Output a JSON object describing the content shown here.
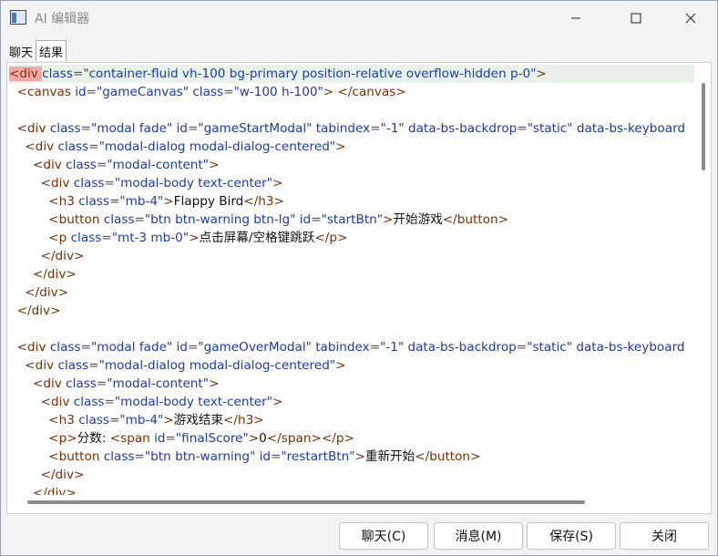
{
  "window": {
    "title": "AI 编辑器"
  },
  "tabs": [
    {
      "label": "聊天",
      "active": false
    },
    {
      "label": "结果",
      "active": true
    }
  ],
  "code_lines": [
    [
      [
        "tag",
        "<div "
      ],
      [
        "attr",
        "class"
      ],
      [
        "eq",
        "="
      ],
      [
        "val",
        "\"container-fluid vh-100 bg-primary position-relative overflow-hidden p-0\""
      ],
      [
        "tag",
        ">"
      ]
    ],
    [
      [
        "text",
        "  "
      ],
      [
        "tag",
        "<canvas "
      ],
      [
        "attr",
        "id"
      ],
      [
        "eq",
        "="
      ],
      [
        "val",
        "\"gameCanvas\""
      ],
      [
        "attr",
        " class"
      ],
      [
        "eq",
        "="
      ],
      [
        "val",
        "\"w-100 h-100\""
      ],
      [
        "tag",
        "> </canvas>"
      ]
    ],
    [],
    [
      [
        "text",
        "  "
      ],
      [
        "tag",
        "<div "
      ],
      [
        "attr",
        "class"
      ],
      [
        "eq",
        "="
      ],
      [
        "val",
        "\"modal fade\""
      ],
      [
        "attr",
        " id"
      ],
      [
        "eq",
        "="
      ],
      [
        "val",
        "\"gameStartModal\""
      ],
      [
        "attr",
        " tabindex"
      ],
      [
        "eq",
        "="
      ],
      [
        "val",
        "\"-1\""
      ],
      [
        "attr",
        " data-bs-backdrop"
      ],
      [
        "eq",
        "="
      ],
      [
        "val",
        "\"static\""
      ],
      [
        "attr",
        " data-bs-keyboard"
      ]
    ],
    [
      [
        "text",
        "    "
      ],
      [
        "tag",
        "<div "
      ],
      [
        "attr",
        "class"
      ],
      [
        "eq",
        "="
      ],
      [
        "val",
        "\"modal-dialog modal-dialog-centered\""
      ],
      [
        "tag",
        ">"
      ]
    ],
    [
      [
        "text",
        "      "
      ],
      [
        "tag",
        "<div "
      ],
      [
        "attr",
        "class"
      ],
      [
        "eq",
        "="
      ],
      [
        "val",
        "\"modal-content\""
      ],
      [
        "tag",
        ">"
      ]
    ],
    [
      [
        "text",
        "        "
      ],
      [
        "tag",
        "<div "
      ],
      [
        "attr",
        "class"
      ],
      [
        "eq",
        "="
      ],
      [
        "val",
        "\"modal-body text-center\""
      ],
      [
        "tag",
        ">"
      ]
    ],
    [
      [
        "text",
        "          "
      ],
      [
        "tag",
        "<h3 "
      ],
      [
        "attr",
        "class"
      ],
      [
        "eq",
        "="
      ],
      [
        "val",
        "\"mb-4\""
      ],
      [
        "tag",
        ">"
      ],
      [
        "text",
        "Flappy Bird"
      ],
      [
        "tag",
        "</h3>"
      ]
    ],
    [
      [
        "text",
        "          "
      ],
      [
        "tag",
        "<button "
      ],
      [
        "attr",
        "class"
      ],
      [
        "eq",
        "="
      ],
      [
        "val",
        "\"btn btn-warning btn-lg\""
      ],
      [
        "attr",
        " id"
      ],
      [
        "eq",
        "="
      ],
      [
        "val",
        "\"startBtn\""
      ],
      [
        "tag",
        ">"
      ],
      [
        "text",
        "开始游戏"
      ],
      [
        "tag",
        "</button>"
      ]
    ],
    [
      [
        "text",
        "          "
      ],
      [
        "tag",
        "<p "
      ],
      [
        "attr",
        "class"
      ],
      [
        "eq",
        "="
      ],
      [
        "val",
        "\"mt-3 mb-0\""
      ],
      [
        "tag",
        ">"
      ],
      [
        "text",
        "点击屏幕/空格键跳跃"
      ],
      [
        "tag",
        "</p>"
      ]
    ],
    [
      [
        "text",
        "        "
      ],
      [
        "tag",
        "</div>"
      ]
    ],
    [
      [
        "text",
        "      "
      ],
      [
        "tag",
        "</div>"
      ]
    ],
    [
      [
        "text",
        "    "
      ],
      [
        "tag",
        "</div>"
      ]
    ],
    [
      [
        "text",
        "  "
      ],
      [
        "tag",
        "</div>"
      ]
    ],
    [],
    [
      [
        "text",
        "  "
      ],
      [
        "tag",
        "<div "
      ],
      [
        "attr",
        "class"
      ],
      [
        "eq",
        "="
      ],
      [
        "val",
        "\"modal fade\""
      ],
      [
        "attr",
        " id"
      ],
      [
        "eq",
        "="
      ],
      [
        "val",
        "\"gameOverModal\""
      ],
      [
        "attr",
        " tabindex"
      ],
      [
        "eq",
        "="
      ],
      [
        "val",
        "\"-1\""
      ],
      [
        "attr",
        " data-bs-backdrop"
      ],
      [
        "eq",
        "="
      ],
      [
        "val",
        "\"static\""
      ],
      [
        "attr",
        " data-bs-keyboard"
      ]
    ],
    [
      [
        "text",
        "    "
      ],
      [
        "tag",
        "<div "
      ],
      [
        "attr",
        "class"
      ],
      [
        "eq",
        "="
      ],
      [
        "val",
        "\"modal-dialog modal-dialog-centered\""
      ],
      [
        "tag",
        ">"
      ]
    ],
    [
      [
        "text",
        "      "
      ],
      [
        "tag",
        "<div "
      ],
      [
        "attr",
        "class"
      ],
      [
        "eq",
        "="
      ],
      [
        "val",
        "\"modal-content\""
      ],
      [
        "tag",
        ">"
      ]
    ],
    [
      [
        "text",
        "        "
      ],
      [
        "tag",
        "<div "
      ],
      [
        "attr",
        "class"
      ],
      [
        "eq",
        "="
      ],
      [
        "val",
        "\"modal-body text-center\""
      ],
      [
        "tag",
        ">"
      ]
    ],
    [
      [
        "text",
        "          "
      ],
      [
        "tag",
        "<h3 "
      ],
      [
        "attr",
        "class"
      ],
      [
        "eq",
        "="
      ],
      [
        "val",
        "\"mb-4\""
      ],
      [
        "tag",
        ">"
      ],
      [
        "text",
        "游戏结束"
      ],
      [
        "tag",
        "</h3>"
      ]
    ],
    [
      [
        "text",
        "          "
      ],
      [
        "tag",
        "<p>"
      ],
      [
        "text",
        "分数: "
      ],
      [
        "tag",
        "<span "
      ],
      [
        "attr",
        "id"
      ],
      [
        "eq",
        "="
      ],
      [
        "val",
        "\"finalScore\""
      ],
      [
        "tag",
        ">"
      ],
      [
        "text",
        "0"
      ],
      [
        "tag",
        "</span></p>"
      ]
    ],
    [
      [
        "text",
        "          "
      ],
      [
        "tag",
        "<button "
      ],
      [
        "attr",
        "class"
      ],
      [
        "eq",
        "="
      ],
      [
        "val",
        "\"btn btn-warning\""
      ],
      [
        "attr",
        " id"
      ],
      [
        "eq",
        "="
      ],
      [
        "val",
        "\"restartBtn\""
      ],
      [
        "tag",
        ">"
      ],
      [
        "text",
        "重新开始"
      ],
      [
        "tag",
        "</button>"
      ]
    ],
    [
      [
        "text",
        "        "
      ],
      [
        "tag",
        "</div>"
      ]
    ],
    [
      [
        "text",
        "      "
      ],
      [
        "tag",
        "</div>"
      ]
    ]
  ],
  "buttons": {
    "chat": "聊天(C)",
    "message": "消息(M)",
    "save": "保存(S)",
    "close": "关闭"
  }
}
